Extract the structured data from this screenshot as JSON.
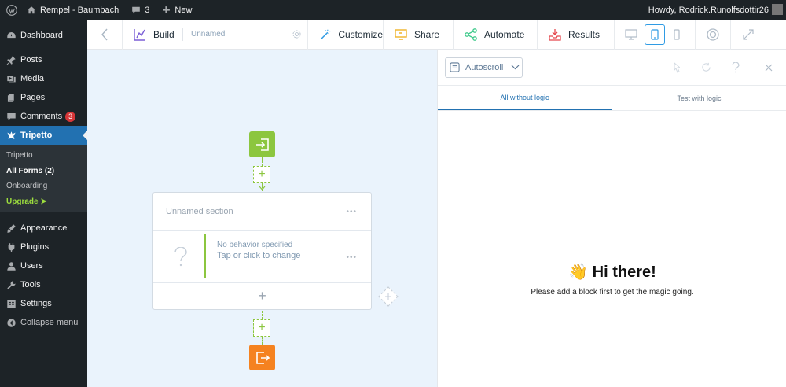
{
  "admin_bar": {
    "site_name": "Rempel - Baumbach",
    "comments_count": "3",
    "new_label": "New",
    "greeting": "Howdy, Rodrick.Runolfsdottir26"
  },
  "sidebar": {
    "items": [
      {
        "label": "Dashboard",
        "icon": "dashboard-icon"
      },
      {
        "label": "Posts",
        "icon": "pin-icon"
      },
      {
        "label": "Media",
        "icon": "media-icon"
      },
      {
        "label": "Pages",
        "icon": "pages-icon"
      },
      {
        "label": "Comments",
        "icon": "comment-icon",
        "badge": "3"
      },
      {
        "label": "Tripetto",
        "icon": "tripetto-icon",
        "active": true
      },
      {
        "label": "Appearance",
        "icon": "brush-icon"
      },
      {
        "label": "Plugins",
        "icon": "plug-icon"
      },
      {
        "label": "Users",
        "icon": "user-icon"
      },
      {
        "label": "Tools",
        "icon": "wrench-icon"
      },
      {
        "label": "Settings",
        "icon": "settings-icon"
      },
      {
        "label": "Collapse menu",
        "icon": "collapse-icon"
      }
    ],
    "submenu": [
      "Tripetto",
      "All Forms (2)",
      "Onboarding",
      "Upgrade ➤"
    ]
  },
  "toolbar": {
    "build": "Build",
    "form_name": "Unnamed",
    "customize": "Customize",
    "share": "Share",
    "automate": "Automate",
    "results": "Results"
  },
  "canvas": {
    "section_title": "Unnamed section",
    "block_hint": "No behavior specified",
    "block_action": "Tap or click to change"
  },
  "preview": {
    "scroll_mode": "Autoscroll",
    "tabs": [
      "All without logic",
      "Test with logic"
    ],
    "heading": "👋 Hi there!",
    "message": "Please add a block first to get the magic going."
  },
  "colors": {
    "wp_dark": "#1d2327",
    "wp_blue": "#2271b1",
    "tripetto_green": "#8cc63f",
    "tripetto_orange": "#f58220",
    "canvas_bg": "#eaf3fc"
  }
}
